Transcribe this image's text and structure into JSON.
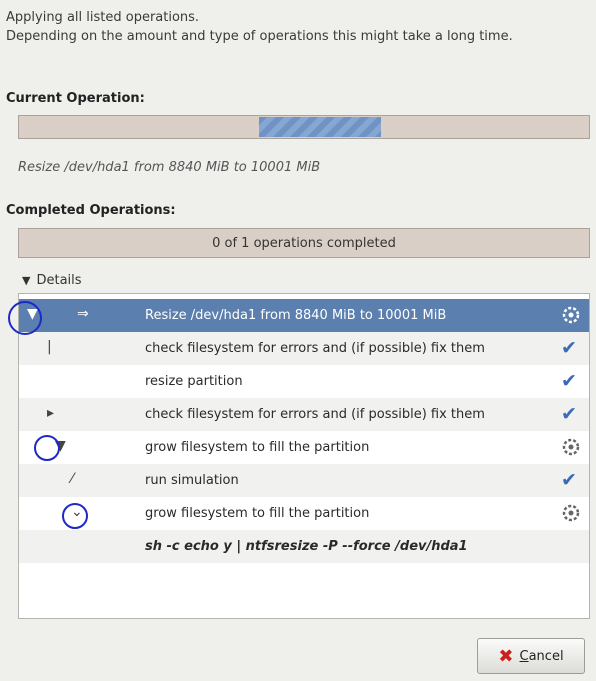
{
  "intro": {
    "line1": "Applying all listed operations.",
    "line2": "Depending on the amount and type of operations this might take a long time."
  },
  "current": {
    "title": "Current Operation:",
    "progress": 0.5,
    "text": "Resize /dev/hda1 from 8840 MiB to 10001 MiB"
  },
  "completed": {
    "title": "Completed Operations:",
    "text": "0 of 1 operations completed"
  },
  "details": {
    "label": "Details"
  },
  "tree": {
    "rows": [
      {
        "label": "Resize /dev/hda1 from 8840 MiB to 10001 MiB",
        "status": "gear-icon",
        "selected": true
      },
      {
        "label": "check filesystem for errors and (if possible) fix them",
        "status": "check-icon"
      },
      {
        "label": "resize partition",
        "status": "check-icon"
      },
      {
        "label": "check filesystem for errors and (if possible) fix them",
        "status": "check-icon"
      },
      {
        "label": "grow filesystem to fill the partition",
        "status": "gear-icon"
      },
      {
        "label": "run simulation",
        "status": "check-icon"
      },
      {
        "label": "grow filesystem to fill the partition",
        "status": "gear-icon"
      },
      {
        "label": "sh -c echo y | ntfsresize -P --force /dev/hda1",
        "status": ""
      }
    ]
  },
  "buttons": {
    "cancel": "Cancel"
  },
  "colors": {
    "selection": "#5b7fae",
    "progress": "#6f93c4",
    "annotation": "#1d29c8",
    "cancel_icon": "#c8221c"
  }
}
